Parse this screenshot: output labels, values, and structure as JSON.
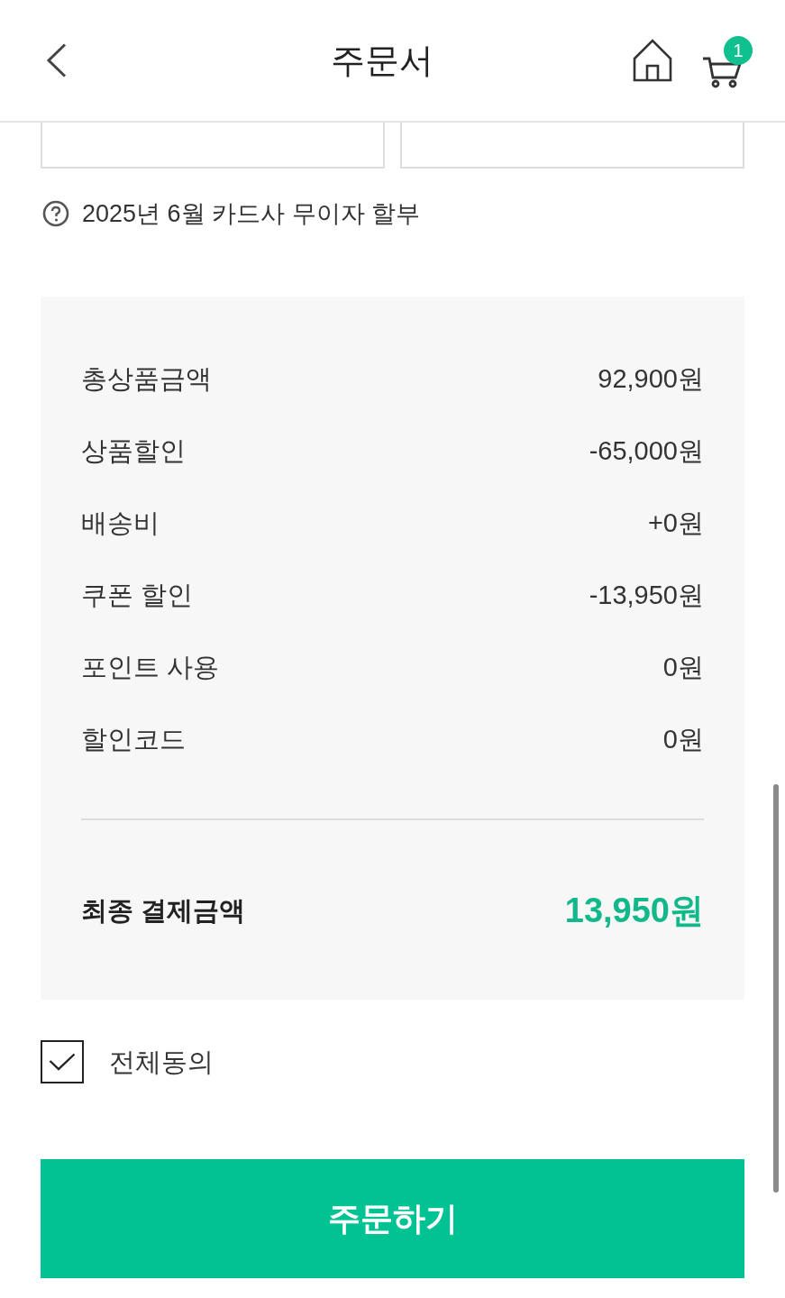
{
  "header": {
    "title": "주문서",
    "cart_badge": "1"
  },
  "installment_note": "2025년 6월 카드사 무이자 할부",
  "summary": {
    "rows": [
      {
        "label": "총상품금액",
        "value": "92,900원"
      },
      {
        "label": "상품할인",
        "value": "-65,000원"
      },
      {
        "label": "배송비",
        "value": "+0원"
      },
      {
        "label": "쿠폰 할인",
        "value": "-13,950원"
      },
      {
        "label": "포인트 사용",
        "value": "0원"
      },
      {
        "label": "할인코드",
        "value": "0원"
      }
    ],
    "total": {
      "label": "최종 결제금액",
      "value": "13,950원"
    }
  },
  "agree_all": {
    "label": "전체동의",
    "checked": true
  },
  "order_button": "주문하기"
}
